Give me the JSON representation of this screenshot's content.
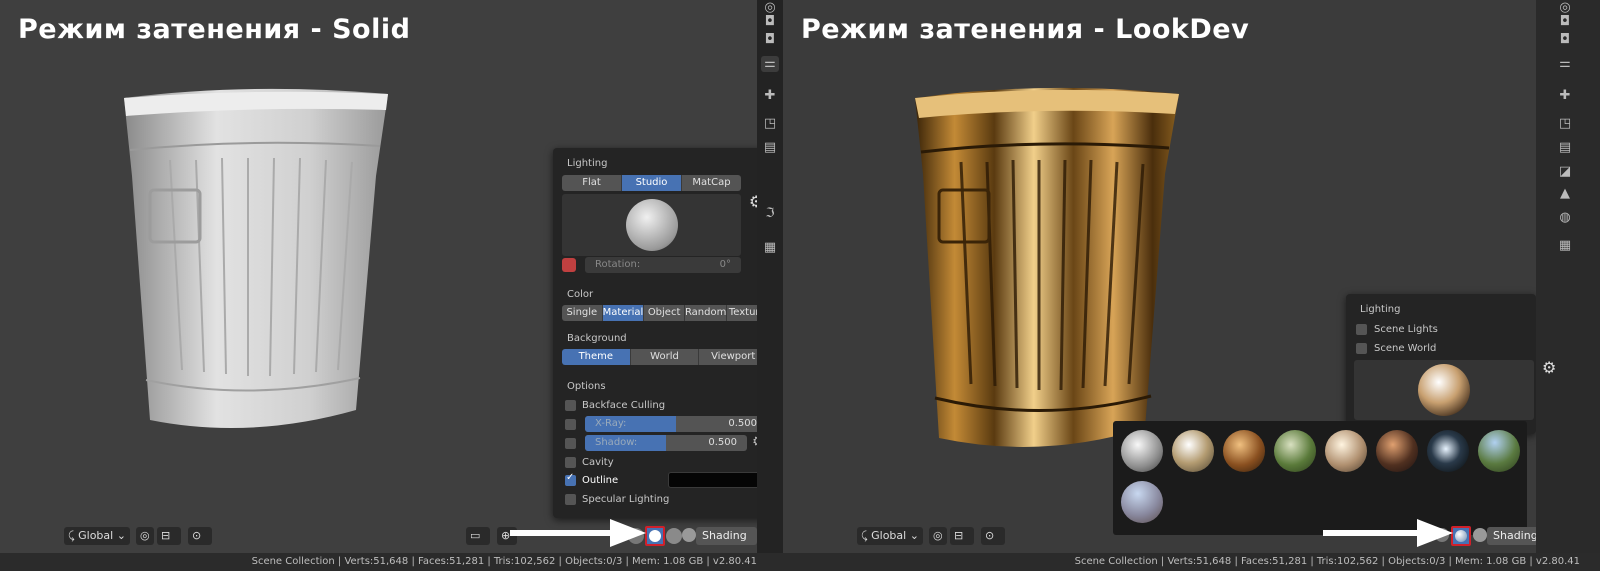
{
  "left": {
    "title": "Режим затенения - Solid",
    "header": {
      "orientation": "Global",
      "shading_label": "Shading"
    },
    "popup": {
      "lighting_label": "Lighting",
      "lighting_options": [
        "Flat",
        "Studio",
        "MatCap"
      ],
      "lighting_selected": "Studio",
      "rotation_label": "Rotation:",
      "rotation_value": "0°",
      "color_label": "Color",
      "color_options": [
        "Single",
        "Material",
        "Object",
        "Random",
        "Texture"
      ],
      "color_selected": "Material",
      "background_label": "Background",
      "background_options": [
        "Theme",
        "World",
        "Viewport"
      ],
      "background_selected": "Theme",
      "options_label": "Options",
      "backface_culling": "Backface Culling",
      "xray_label": "X-Ray:",
      "xray_value": "0.500",
      "shadow_label": "Shadow:",
      "shadow_value": "0.500",
      "cavity": "Cavity",
      "outline": "Outline",
      "specular": "Specular Lighting"
    },
    "status": "Scene Collection | Verts:51,648 | Faces:51,281 | Tris:102,562 | Objects:0/3 | Mem: 1.08 GB | v2.80.41"
  },
  "right": {
    "title": "Режим затенения - LookDev",
    "header": {
      "orientation": "Global",
      "shading_label": "Shading"
    },
    "popup": {
      "lighting_label": "Lighting",
      "scene_lights": "Scene Lights",
      "scene_world": "Scene World"
    },
    "status": "Scene Collection | Verts:51,648 | Faces:51,281 | Tris:102,562 | Objects:0/3 | Mem: 1.08 GB | v2.80.41"
  },
  "colors": {
    "accent": "#4772b3",
    "highlight_border": "#d0202a",
    "gold": "#b8862e"
  }
}
